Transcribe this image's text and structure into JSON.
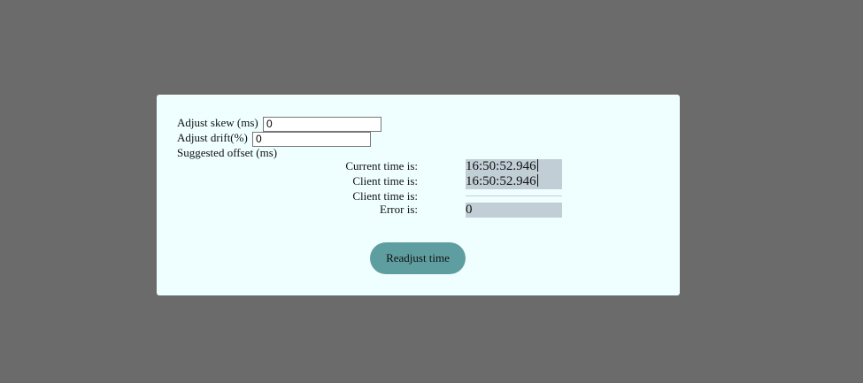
{
  "form": {
    "skew_label": "Adjust skew (ms)",
    "skew_value": "0",
    "drift_label": "Adjust drift(%)",
    "drift_value": "0",
    "offset_label": "Suggested offset (ms)"
  },
  "times": {
    "current_label": "Current time is:",
    "current_value": "16:50:52.946",
    "client_label": "Client time is:",
    "client_value": "16:50:52.946",
    "client2_label": "Client time is:",
    "error_label": "Error is:",
    "error_value": "0"
  },
  "actions": {
    "readjust_label": "Readjust time"
  },
  "colors": {
    "background": "#6b6b6b",
    "panel": "#efffff",
    "value_box": "#c1ced6",
    "button": "#5f9ea0"
  }
}
